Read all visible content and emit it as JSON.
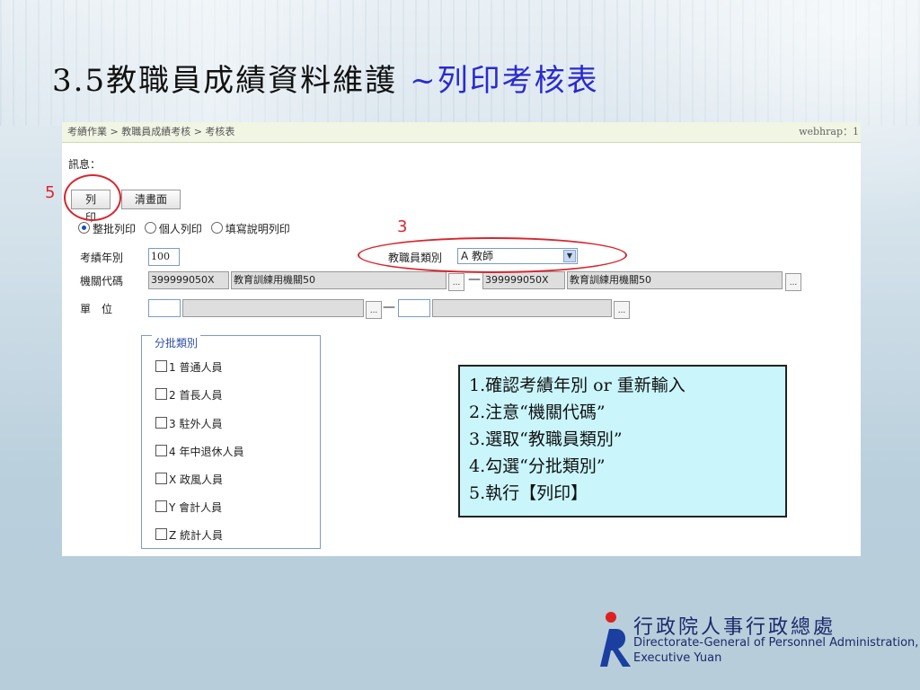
{
  "slide": {
    "title": "3.5教職員成績資料維護",
    "subtitle": "~列印考核表"
  },
  "app": {
    "breadcrumb": "考績作業 > 教職員成績考核 > 考核表",
    "user": "webhrap：1",
    "message_label": "訊息：",
    "buttons": {
      "print": "列印",
      "clear": "清畫面"
    },
    "print_modes": [
      "整批列印",
      "個人列印",
      "填寫說明列印"
    ],
    "selected_print_mode": "整批列印",
    "fields": {
      "year_label": "考績年別",
      "year_value": "100",
      "staff_type_label": "教職員類別",
      "staff_type_value": "A 教師",
      "agency_label": "機關代碼",
      "agency_code_from": "399999050X",
      "agency_name_from": "教育訓練用機關50",
      "agency_code_to": "399999050X",
      "agency_name_to": "教育訓練用機關50",
      "unit_label": "單　位",
      "dots": "...",
      "dash": "—"
    },
    "batch_group": {
      "legend": "分批類別",
      "items": [
        "1 普通人員",
        "2 首長人員",
        "3 駐外人員",
        "4 年中退休人員",
        "X 政風人員",
        "Y 會計人員",
        "Z 統計人員"
      ]
    }
  },
  "annotations": {
    "marker_print": "5",
    "marker_staff": "3",
    "steps": [
      "1.確認考績年別 or 重新輸入",
      "2.注意“機關代碼”",
      "3.選取“教職員類別”",
      "4.勾選“分批類別”",
      "5.執行【列印】"
    ],
    "color": "#d8262e"
  },
  "logo": {
    "chinese": "行政院人事行政總處",
    "english_line1": "Directorate-General of Personnel Administration,",
    "english_line2": "Executive Yuan"
  }
}
